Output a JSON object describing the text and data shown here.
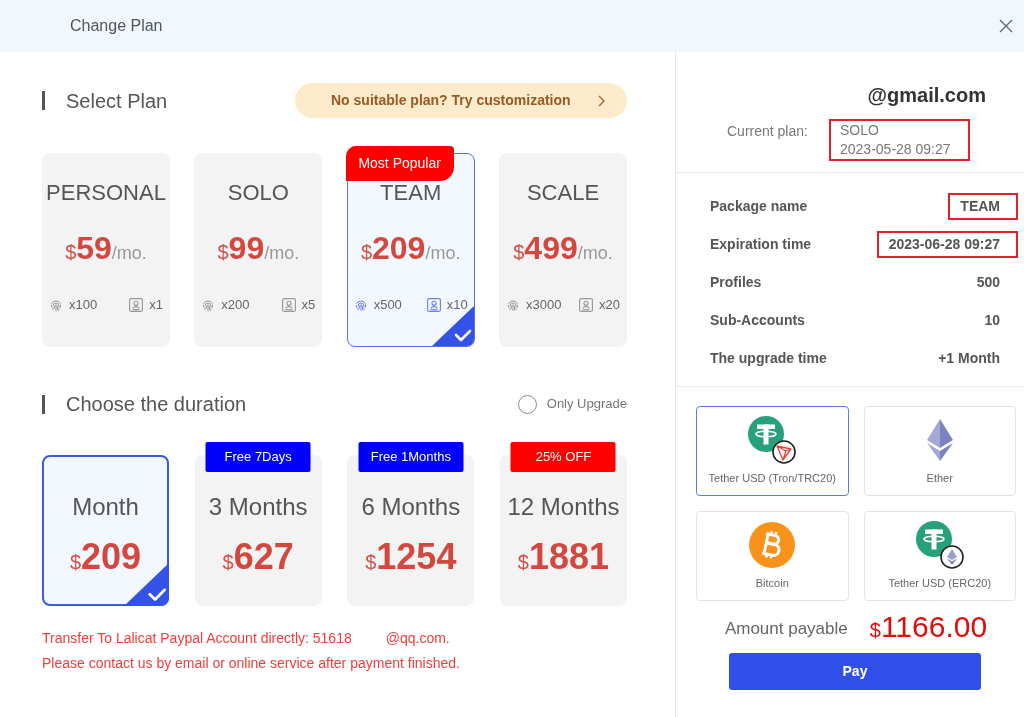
{
  "dialog": {
    "title": "Change Plan"
  },
  "plan_section": {
    "heading": "Select Plan",
    "customization_link": "No suitable plan? Try customization",
    "plans": [
      {
        "name": "PERSONAL",
        "currency": "$",
        "price": "59",
        "unit": "/mo.",
        "profiles": "x100",
        "sub_accounts": "x1",
        "selected": false
      },
      {
        "name": "SOLO",
        "currency": "$",
        "price": "99",
        "unit": "/mo.",
        "profiles": "x200",
        "sub_accounts": "x5",
        "selected": false
      },
      {
        "name": "TEAM",
        "badge": "Most Popular",
        "currency": "$",
        "price": "209",
        "unit": "/mo.",
        "profiles": "x500",
        "sub_accounts": "x10",
        "selected": true
      },
      {
        "name": "SCALE",
        "currency": "$",
        "price": "499",
        "unit": "/mo.",
        "profiles": "x3000",
        "sub_accounts": "x20",
        "selected": false
      }
    ]
  },
  "duration_section": {
    "heading": "Choose the duration",
    "only_upgrade": {
      "label": "Only Upgrade",
      "checked": false
    },
    "options": [
      {
        "label": "Month",
        "currency": "$",
        "price": "209",
        "selected": true
      },
      {
        "label": "3 Months",
        "badge": {
          "text": "Free 7Days",
          "color": "#0000ff"
        },
        "currency": "$",
        "price": "627",
        "selected": false
      },
      {
        "label": "6 Months",
        "badge": {
          "text": "Free 1Months",
          "color": "#0000ff"
        },
        "currency": "$",
        "price": "1254",
        "selected": false
      },
      {
        "label": "12 Months",
        "badge": {
          "text": "25% OFF",
          "color": "#ff0000"
        },
        "currency": "$",
        "price": "1881",
        "selected": false
      }
    ],
    "notice": [
      {
        "segments": [
          "Transfer To Lalicat Paypal Account directly: 51618",
          "@qq.com."
        ]
      },
      {
        "segments": [
          "Please contact us by email or online service after payment finished."
        ]
      }
    ]
  },
  "order_panel": {
    "email": "@gmail.com",
    "current_plan": {
      "label": "Current plan:",
      "lines": [
        "SOLO",
        "2023-05-28 09:27"
      ],
      "highlighted": true
    },
    "details": [
      {
        "label": "Package name",
        "value": "TEAM",
        "highlighted": true
      },
      {
        "label": "Expiration time",
        "value": "2023-06-28 09:27",
        "highlighted": true
      },
      {
        "label": "Profiles",
        "value": "500",
        "highlighted": false
      },
      {
        "label": "Sub-Accounts",
        "value": "10",
        "highlighted": false
      },
      {
        "label": "The upgrade time",
        "value": "+1 Month",
        "highlighted": false
      }
    ],
    "payment_methods": [
      {
        "name": "Tether USD (Tron/TRC20)",
        "kind": "tether-tron",
        "selected": true
      },
      {
        "name": "Ether",
        "kind": "ether",
        "selected": false
      },
      {
        "name": "Bitcoin",
        "kind": "bitcoin",
        "selected": false
      },
      {
        "name": "Tether USD (ERC20)",
        "kind": "tether-erc20",
        "selected": false
      }
    ],
    "amount": {
      "label": "Amount payable",
      "currency": "$",
      "value": "1166.00"
    },
    "pay_button": "Pay"
  }
}
